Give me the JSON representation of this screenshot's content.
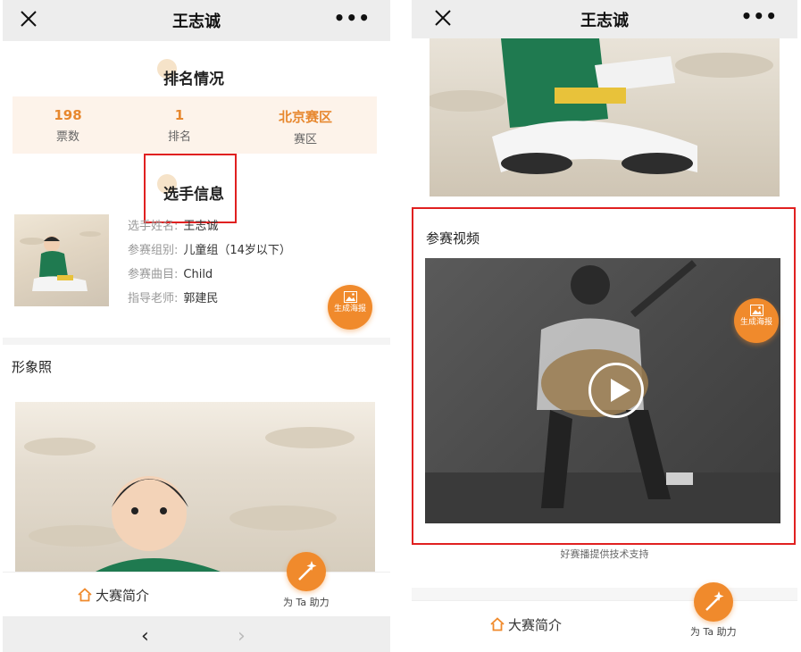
{
  "left": {
    "title": "王志诚",
    "ranking_heading": "排名情况",
    "stats": [
      {
        "value": "198",
        "label": "票数"
      },
      {
        "value": "1",
        "label": "排名"
      },
      {
        "value": "北京赛区",
        "label": "赛区"
      }
    ],
    "info_heading": "选手信息",
    "info": {
      "name_label": "选手姓名:",
      "name_value": "王志诚",
      "group_label": "参赛组别:",
      "group_value": "儿童组（14岁以下）",
      "song_label": "参赛曲目:",
      "song_value": "Child",
      "teacher_label": "指导老师:",
      "teacher_value": "郭建民"
    },
    "poster_label": "生成海报",
    "photo_heading": "形象照",
    "bottom_intro": "大赛简介",
    "bottom_help": "为 Ta 助力",
    "nav_back": "‹",
    "nav_forward": "›"
  },
  "right": {
    "title": "王志诚",
    "video_heading": "参赛视频",
    "poster_label": "生成海报",
    "tech_support": "好赛播提供技术支持",
    "bottom_intro": "大赛简介",
    "bottom_help": "为 Ta 助力"
  },
  "icons": {
    "close": "close-icon",
    "more": "more-icon",
    "home": "home-icon",
    "magic_wand": "magic-wand-icon",
    "image": "image-icon",
    "play": "play-icon"
  },
  "colors": {
    "accent": "#f08a2c",
    "stat_value": "#e7882f",
    "stats_bg": "#fdf3ea",
    "highlight_box": "#e02020",
    "topbar_bg": "#ededed"
  }
}
